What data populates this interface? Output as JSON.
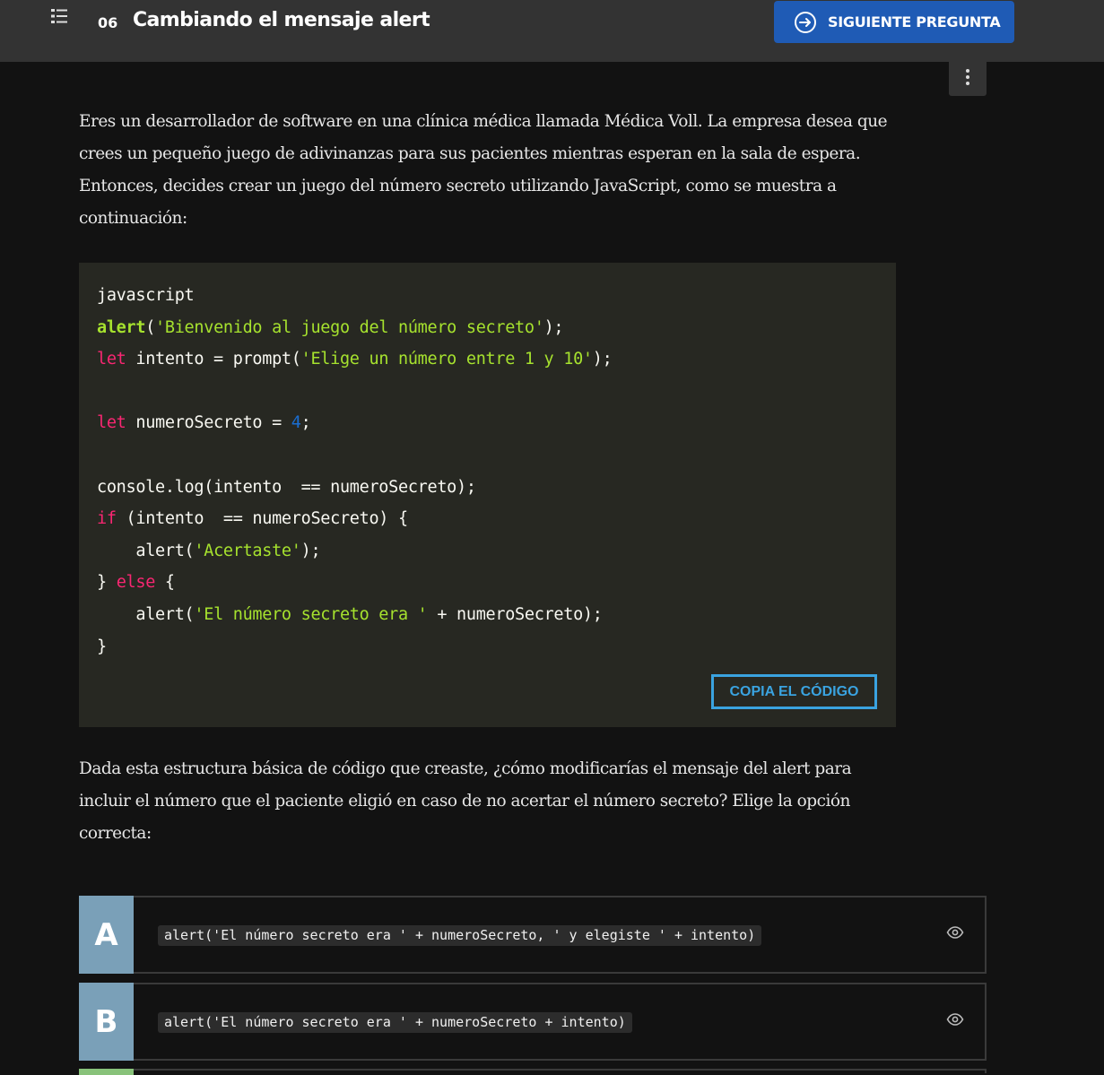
{
  "header": {
    "lesson_number": "06",
    "lesson_title": "Cambiando el mensaje alert",
    "next_button_label": "SIGUIENTE PREGUNTA",
    "menu_icon": "list-icon",
    "more_icon": "kebab-icon"
  },
  "content": {
    "intro_paragraph": "Eres un desarrollador de software en una clínica médica llamada Médica Voll. La empresa desea que crees un pequeño juego de adivinanzas para sus pacientes mientras esperan en la sala de espera. Entonces, decides crear un juego del número secreto utilizando JavaScript, como se muestra a continuación:",
    "code_lines": [
      "javascript",
      "alert('Bienvenido al juego del número secreto');",
      "let intento = prompt('Elige un número entre 1 y 10');",
      "",
      "let numeroSecreto = 4;",
      "",
      "console.log(intento  == numeroSecreto);",
      "if (intento  == numeroSecreto) {",
      "    alert('Acertaste');",
      "} else {",
      "    alert('El número secreto era ' + numeroSecreto);",
      "}"
    ],
    "copy_button_label": "COPIA EL CÓDIGO",
    "question_paragraph": "Dada esta estructura básica de código que creaste, ¿cómo modificarías el mensaje del alert para incluir el número que el paciente eligió en caso de no acertar el número secreto? Elige la opción correcta:"
  },
  "options": [
    {
      "letter": "A",
      "code": "alert('El número secreto era ' + numeroSecreto, ' y elegiste ' + intento)",
      "icon": "eye-icon"
    },
    {
      "letter": "B",
      "code": "alert('El número secreto era ' + numeroSecreto + intento)",
      "icon": "eye-icon"
    }
  ],
  "colors": {
    "topbar": "#333333",
    "accent_button": "#1f5bb5",
    "code_background": "#272822",
    "keyword": "#f92672",
    "string": "#a6e22e",
    "number": "#1a6ed1",
    "copy_button": "#3aa3e0",
    "option_letter_bg": "#7aa0b8",
    "option_c_bg": "#88c27a"
  }
}
